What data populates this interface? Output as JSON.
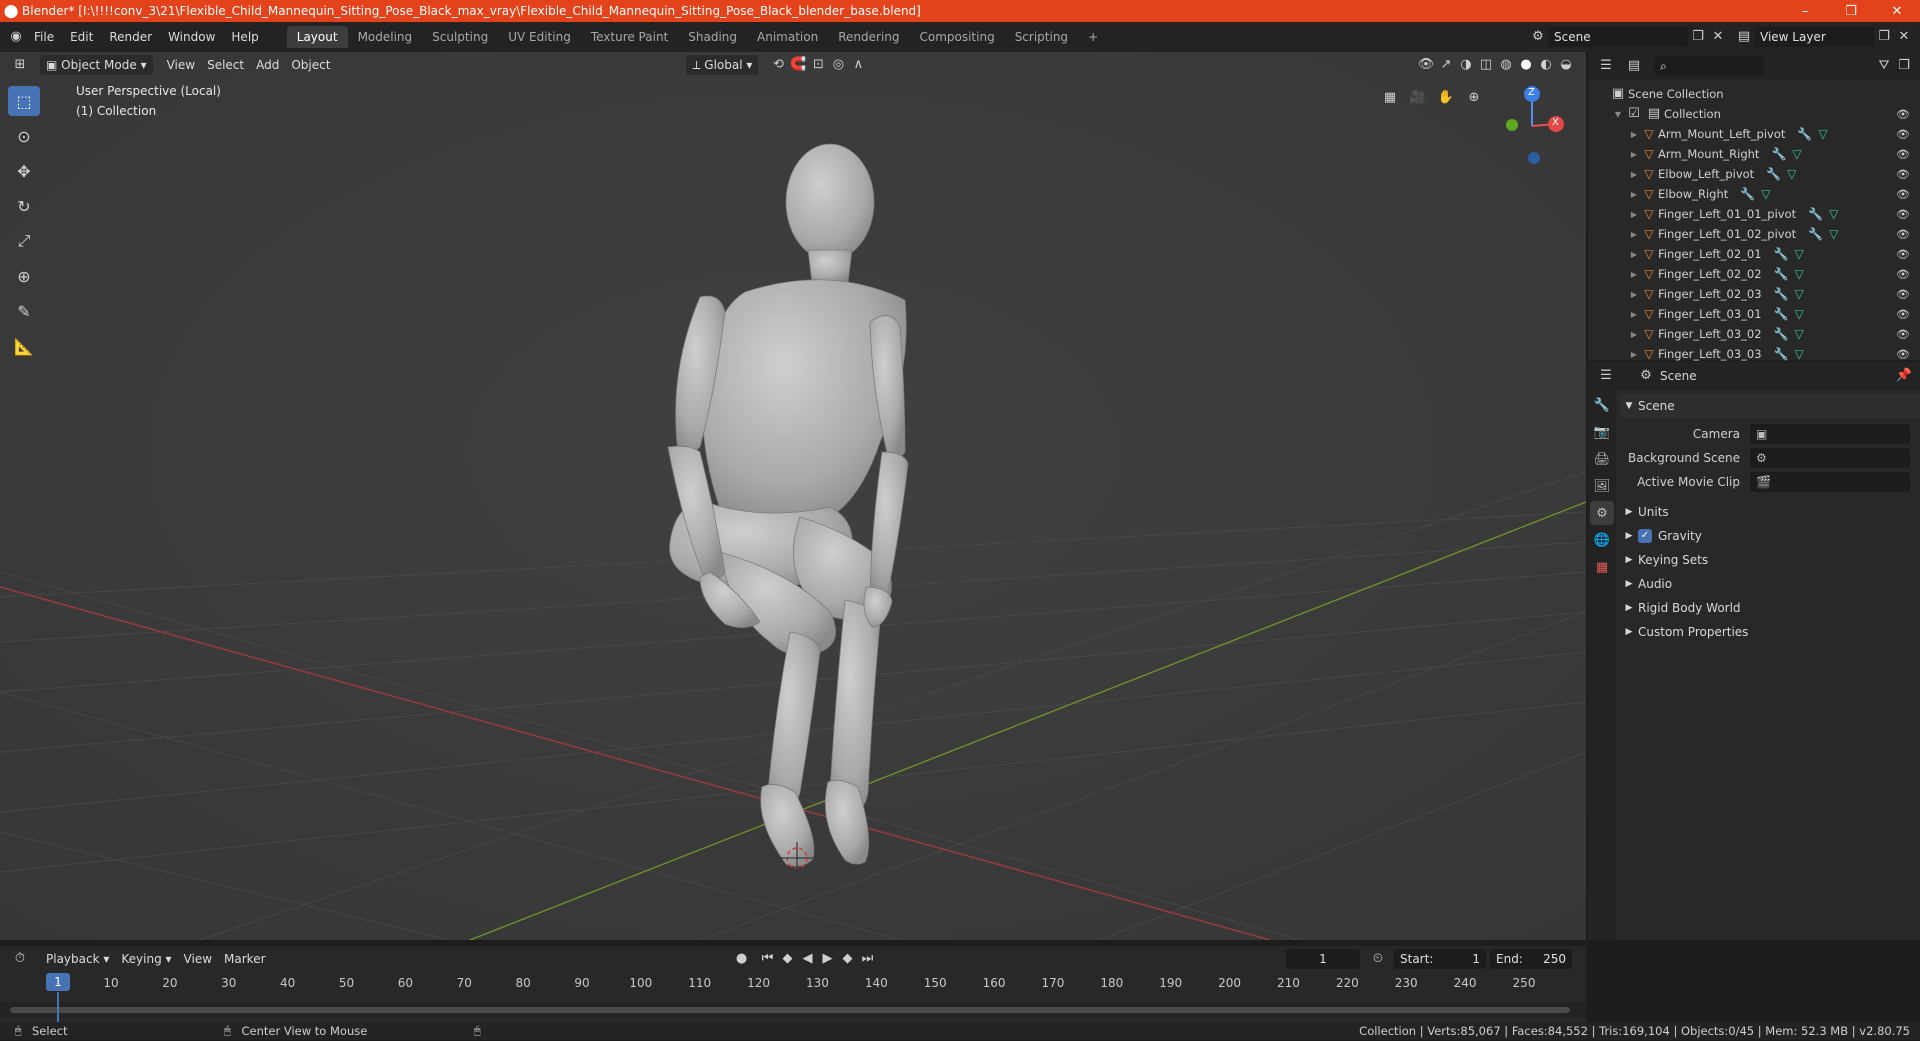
{
  "titlebar": {
    "title": "Blender* [I:\\!!!!conv_3\\21\\Flexible_Child_Mannequin_Sitting_Pose_Black_max_vray\\Flexible_Child_Mannequin_Sitting_Pose_Black_blender_base.blend]",
    "minimize": "–",
    "maximize": "❐",
    "close": "✕"
  },
  "menus": [
    "File",
    "Edit",
    "Render",
    "Window",
    "Help"
  ],
  "workspaces": [
    "Layout",
    "Modeling",
    "Sculpting",
    "UV Editing",
    "Texture Paint",
    "Shading",
    "Animation",
    "Rendering",
    "Compositing",
    "Scripting"
  ],
  "workspace_add": "+",
  "scene": {
    "value": "Scene"
  },
  "view_layer": {
    "value": "View Layer"
  },
  "viewport": {
    "mode": "Object Mode",
    "menus": [
      "View",
      "Select",
      "Add",
      "Object"
    ],
    "transform_orientation": "Global",
    "overlay_text_1": "User Perspective (Local)",
    "overlay_text_2": "(1) Collection",
    "gizmo_z": "Z",
    "gizmo_x": "X"
  },
  "outliner": {
    "root": "Scene Collection",
    "collection": "Collection",
    "items": [
      "Arm_Mount_Left_pivot",
      "Arm_Mount_Right",
      "Elbow_Left_pivot",
      "Elbow_Right",
      "Finger_Left_01_01_pivot",
      "Finger_Left_01_02_pivot",
      "Finger_Left_02_01",
      "Finger_Left_02_02",
      "Finger_Left_02_03",
      "Finger_Left_03_01",
      "Finger_Left_03_02",
      "Finger_Left_03_03"
    ]
  },
  "properties": {
    "header": "Scene",
    "panel_title": "Scene",
    "camera_label": "Camera",
    "background_scene_label": "Background Scene",
    "active_movie_clip_label": "Active Movie Clip",
    "subpanels": [
      "Units",
      "Gravity",
      "Keying Sets",
      "Audio",
      "Rigid Body World",
      "Custom Properties"
    ]
  },
  "timeline": {
    "menus": [
      "Playback",
      "Keying",
      "View",
      "Marker"
    ],
    "current_frame": "1",
    "start_label": "Start:",
    "start_value": "1",
    "end_label": "End:",
    "end_value": "250",
    "ticks": [
      "1",
      "10",
      "20",
      "30",
      "40",
      "50",
      "60",
      "70",
      "80",
      "90",
      "100",
      "110",
      "120",
      "130",
      "140",
      "150",
      "160",
      "170",
      "180",
      "190",
      "200",
      "210",
      "220",
      "230",
      "240",
      "250"
    ]
  },
  "statusbar": {
    "left": "Select",
    "middle": "Center View to Mouse",
    "right": "Collection | Verts:85,067 | Faces:84,552 | Tris:169,104 | Objects:0/45 | Mem: 52.3 MB | v2.80.75"
  }
}
